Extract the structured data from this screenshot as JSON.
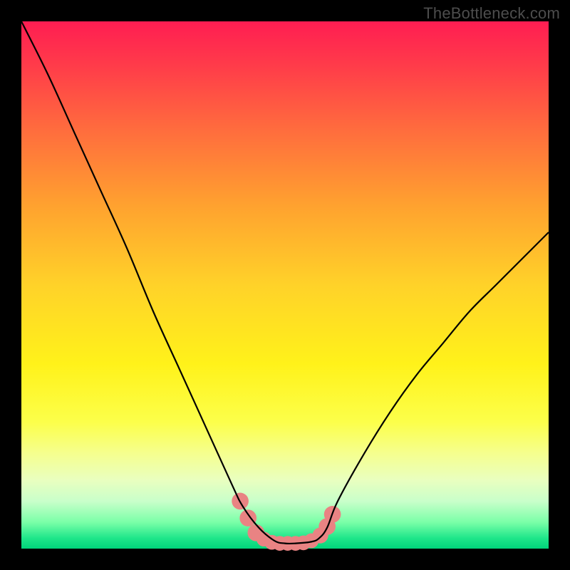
{
  "watermark": "TheBottleneck.com",
  "chart_data": {
    "type": "line",
    "title": "",
    "xlabel": "",
    "ylabel": "",
    "xlim": [
      0,
      100
    ],
    "ylim": [
      0,
      100
    ],
    "grid": false,
    "legend": false,
    "series": [
      {
        "name": "curve",
        "color": "#000000",
        "x": [
          0,
          5,
          10,
          15,
          20,
          25,
          30,
          35,
          40,
          42,
          45,
          48,
          50,
          52,
          55,
          56.5,
          58,
          60,
          65,
          70,
          75,
          80,
          85,
          90,
          95,
          100
        ],
        "y": [
          100,
          90,
          79,
          68,
          57,
          45,
          34,
          23,
          12,
          8,
          4,
          1.5,
          1,
          1,
          1.3,
          2,
          4,
          9,
          18,
          26,
          33,
          39,
          45,
          50,
          55,
          60
        ]
      }
    ],
    "markers": {
      "name": "highlight-dots",
      "color": "#e98383",
      "points": [
        {
          "x": 41.5,
          "y": 9.0,
          "r": 1.6
        },
        {
          "x": 43.0,
          "y": 5.8,
          "r": 1.6
        },
        {
          "x": 44.5,
          "y": 3.0,
          "r": 1.6
        },
        {
          "x": 46.0,
          "y": 1.8,
          "r": 1.4
        },
        {
          "x": 47.5,
          "y": 1.2,
          "r": 1.4
        },
        {
          "x": 49.0,
          "y": 1.0,
          "r": 1.4
        },
        {
          "x": 50.5,
          "y": 1.0,
          "r": 1.4
        },
        {
          "x": 52.0,
          "y": 1.0,
          "r": 1.4
        },
        {
          "x": 53.5,
          "y": 1.1,
          "r": 1.4
        },
        {
          "x": 55.0,
          "y": 1.5,
          "r": 1.4
        },
        {
          "x": 56.7,
          "y": 2.5,
          "r": 1.5
        },
        {
          "x": 58.0,
          "y": 4.2,
          "r": 1.6
        },
        {
          "x": 59.0,
          "y": 6.5,
          "r": 1.6
        }
      ]
    }
  }
}
